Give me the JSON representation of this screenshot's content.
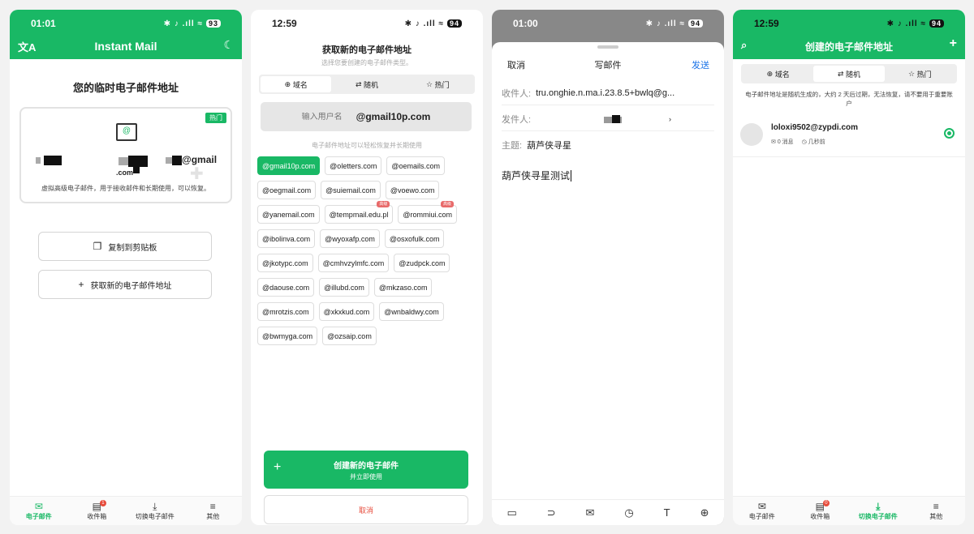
{
  "phone1": {
    "status": {
      "time": "01:01",
      "icons": "✱ ♪ .ıll ≈",
      "battery": "93"
    },
    "app_title": "Instant Mail",
    "heading": "您的临时电子邮件地址",
    "badge_hot": "热门",
    "address_suffix": "@gmail",
    "address_tail": ".com",
    "card_desc": "虚拟高级电子邮件，用于接收邮件和长期使用，可以恢复。",
    "copy_label": "复制到剪贴板",
    "new_label": "获取新的电子邮件地址",
    "tabs": [
      {
        "label": "电子邮件",
        "icon": "✉"
      },
      {
        "label": "收件箱",
        "icon": "▤",
        "badge": "1"
      },
      {
        "label": "切换电子邮件",
        "icon": "⤓"
      },
      {
        "label": "其他",
        "icon": "≡"
      }
    ]
  },
  "phone2": {
    "status": {
      "time": "12:59",
      "icons": "✱ ♪ .ıll ≈",
      "battery": "94"
    },
    "title": "获取新的电子邮件地址",
    "subtitle": "选择您要创建的电子邮件类型。",
    "segments": [
      {
        "label": "域名",
        "icon": "⊕"
      },
      {
        "label": "随机",
        "icon": "⇄"
      },
      {
        "label": "热门",
        "icon": "☆"
      }
    ],
    "username_placeholder": "输入用户名",
    "domain": "@gmail10p.com",
    "hint": "电子邮件地址可以轻松恢复并长期使用",
    "adv_badge": "高级",
    "chips": [
      "@gmail10p.com",
      "@oletters.com",
      "@oemails.com",
      "@oegmail.com",
      "@suiemail.com",
      "@voewo.com",
      "@yanemail.com",
      "@tempmail.edu.pl",
      "@rommiui.com",
      "@ibolinva.com",
      "@wyoxafp.com",
      "@osxofulk.com",
      "@jkotypc.com",
      "@cmhvzylmfc.com",
      "@zudpck.com",
      "@daouse.com",
      "@illubd.com",
      "@mkzaso.com",
      "@mrotzis.com",
      "@xkxkud.com",
      "@wnbaldwy.com",
      "@bwmyga.com",
      "@ozsaip.com"
    ],
    "create_title": "创建新的电子邮件",
    "create_sub": "并立即使用",
    "cancel": "取消"
  },
  "phone3": {
    "status": {
      "time": "01:00",
      "icons": "✱ ♪ .ıll ≈",
      "battery": "94"
    },
    "cancel": "取消",
    "title": "写邮件",
    "send": "发送",
    "to_label": "收件人:",
    "to_value": "tru.onghie.n.ma.i.23.8.5+bwlq@g...",
    "from_label": "发件人:",
    "subject_label": "主题:",
    "subject_value": "葫芦侠寻星",
    "body": "葫芦侠寻星测试",
    "toolbar_icons": [
      "image-icon",
      "link-icon",
      "mail-icon",
      "clock-icon",
      "text-icon",
      "add-icon"
    ]
  },
  "phone4": {
    "status": {
      "time": "12:59",
      "icons": "✱ ♪ .ıll ≈",
      "battery": "94"
    },
    "title": "创建的电子邮件地址",
    "segments": [
      {
        "label": "域名",
        "icon": "⊕"
      },
      {
        "label": "随机",
        "icon": "⇄"
      },
      {
        "label": "热门",
        "icon": "☆"
      }
    ],
    "note": "电子邮件地址是随机生成的，大约 2 天后过期，无法恢复，请不要用于重要账户",
    "email": "loloxi9502@zypdi.com",
    "messages": "0 消息",
    "time_ago": "几秒前",
    "tabs": [
      {
        "label": "电子邮件",
        "icon": "✉"
      },
      {
        "label": "收件箱",
        "icon": "▤",
        "badge": "0"
      },
      {
        "label": "切换电子邮件",
        "icon": "⤓"
      },
      {
        "label": "其他",
        "icon": "≡"
      }
    ]
  },
  "colors": {
    "accent": "#19b865",
    "link": "#1a73e8",
    "danger": "#e74c3c"
  }
}
